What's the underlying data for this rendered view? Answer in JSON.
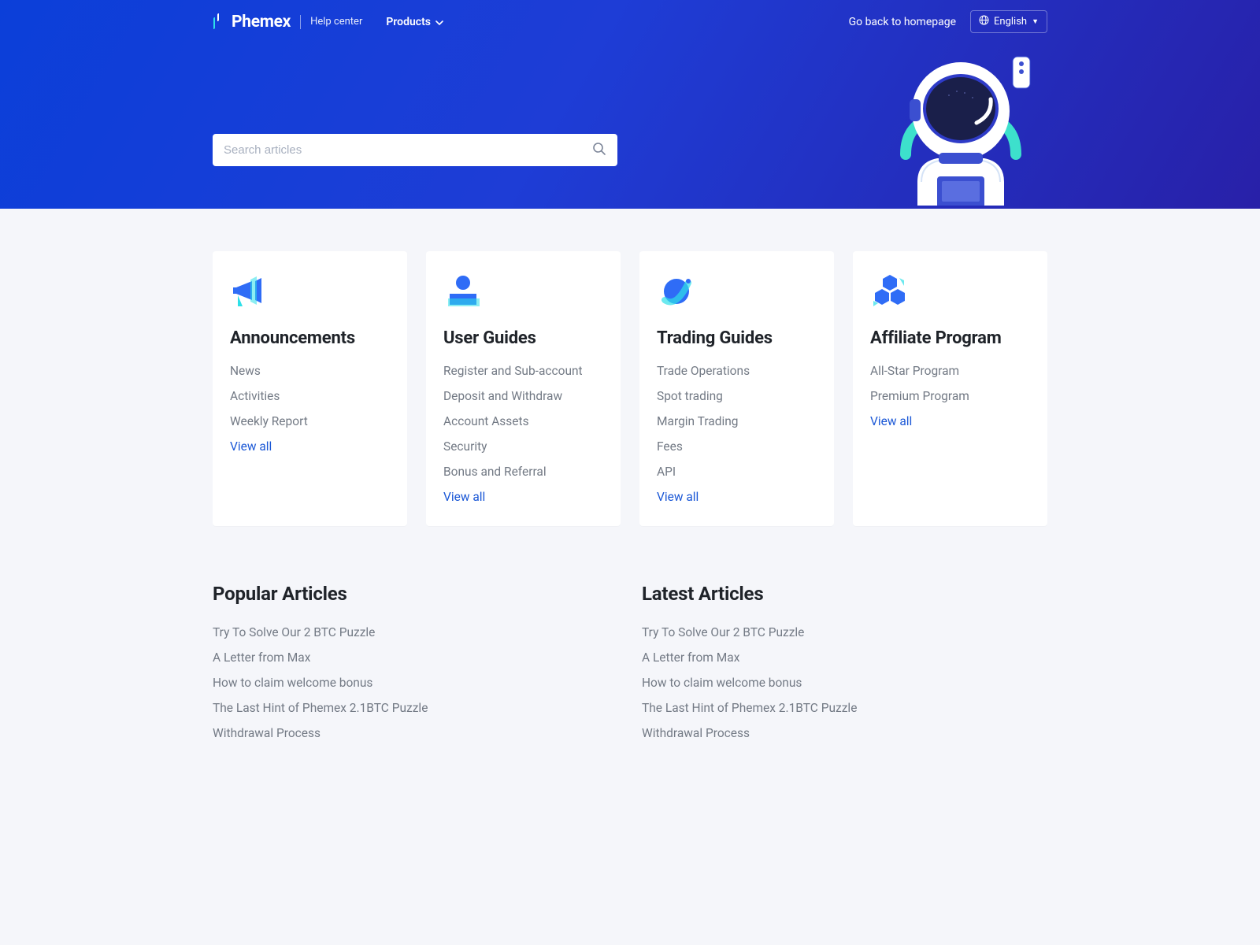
{
  "header": {
    "brand": "Phemex",
    "help_center": "Help center",
    "products": "Products",
    "homepage": "Go back to homepage",
    "language": "English"
  },
  "search": {
    "placeholder": "Search articles"
  },
  "cards": [
    {
      "title": "Announcements",
      "items": [
        "News",
        "Activities",
        "Weekly Report"
      ],
      "view_all": "View all"
    },
    {
      "title": "User Guides",
      "items": [
        "Register and Sub-account",
        "Deposit and Withdraw",
        "Account Assets",
        "Security",
        "Bonus and Referral"
      ],
      "view_all": "View all"
    },
    {
      "title": "Trading Guides",
      "items": [
        "Trade Operations",
        "Spot trading",
        "Margin Trading",
        "Fees",
        "API"
      ],
      "view_all": "View all"
    },
    {
      "title": "Affiliate Program",
      "items": [
        "All-Star Program",
        "Premium Program"
      ],
      "view_all": "View all"
    }
  ],
  "popular": {
    "title": "Popular Articles",
    "items": [
      "Try To Solve Our 2 BTC Puzzle",
      "A Letter from Max",
      "How to claim welcome bonus",
      "The Last Hint of Phemex 2.1BTC Puzzle",
      "Withdrawal Process"
    ]
  },
  "latest": {
    "title": "Latest Articles",
    "items": [
      "Try To Solve Our 2 BTC Puzzle",
      "A Letter from Max",
      "How to claim welcome bonus",
      "The Last Hint of Phemex 2.1BTC Puzzle",
      "Withdrawal Process"
    ]
  }
}
